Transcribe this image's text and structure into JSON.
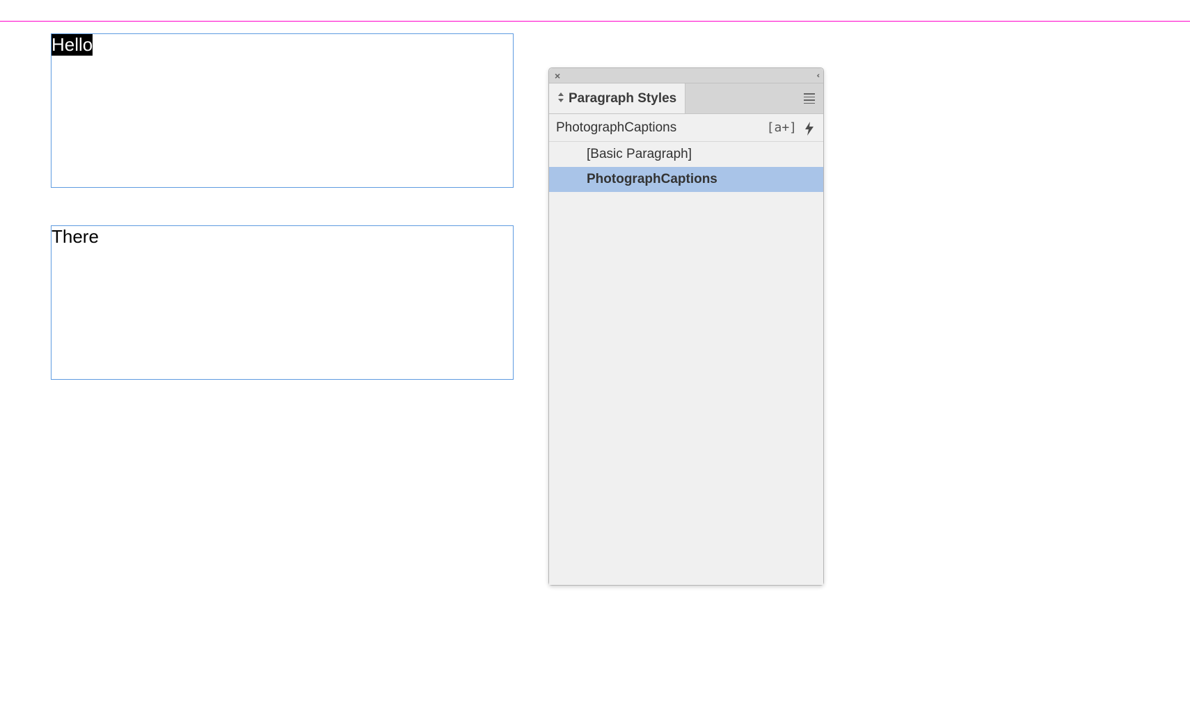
{
  "guide": true,
  "frames": {
    "frame1": {
      "text": "Hello",
      "selected": true
    },
    "frame2": {
      "text": "There",
      "selected": false
    }
  },
  "panel": {
    "tab_label": "Paragraph Styles",
    "current_style": "PhotographCaptions",
    "override_icon": "[a+]",
    "styles": [
      {
        "name": "[Basic Paragraph]",
        "selected": false
      },
      {
        "name": "PhotographCaptions",
        "selected": true
      }
    ]
  }
}
